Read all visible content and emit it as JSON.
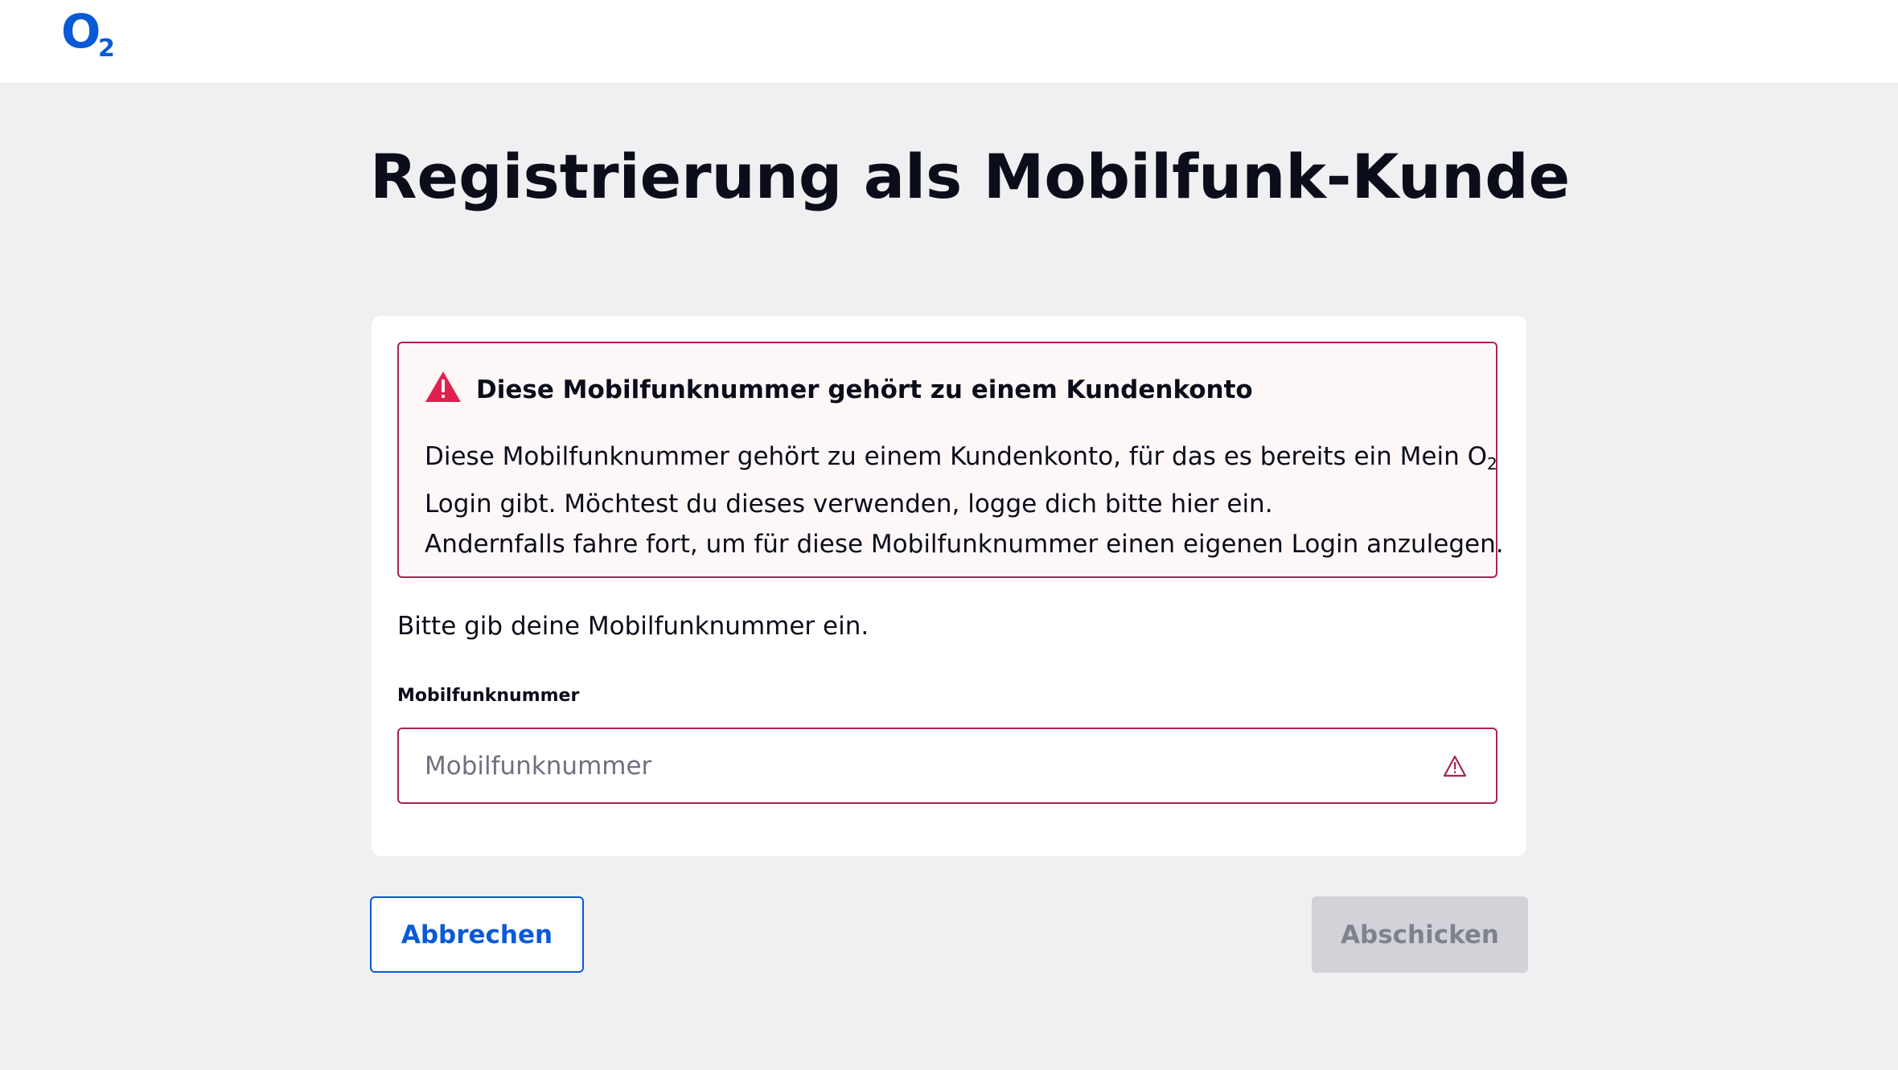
{
  "header": {
    "logo_text": "O",
    "logo_sub": "2",
    "brand_color": "#0a5ad6"
  },
  "page": {
    "title": "Registrierung als Mobilfunk-Kunde"
  },
  "alert": {
    "icon": "warning-triangle-icon",
    "title": "Diese Mobilfunknummer gehört zu einem Kundenkonto",
    "line1_prefix": "Diese Mobilfunknummer gehört zu einem Kundenkonto, für das es bereits ein Mein O",
    "line1_sub": "2",
    "line2": "Login gibt. Möchtest du dieses verwenden, logge dich bitte hier ein.",
    "line3": "Andernfalls fahre fort, um für diese Mobilfunknummer einen eigenen Login anzulegen.",
    "border_color": "#a8254a",
    "icon_color": "#e0204f"
  },
  "form": {
    "instruction": "Bitte gib deine Mobilfunknummer ein.",
    "phone_label": "Mobilfunknummer",
    "phone_placeholder": "Mobilfunknummer",
    "phone_value": "",
    "phone_icon": "warning-outline-icon"
  },
  "actions": {
    "cancel_label": "Abbrechen",
    "submit_label": "Abschicken"
  }
}
